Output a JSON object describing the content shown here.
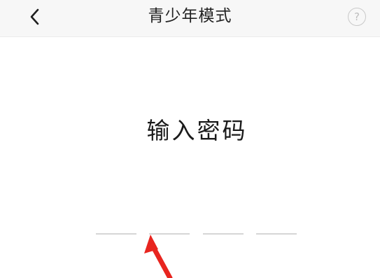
{
  "header": {
    "title": "青少年模式",
    "back_icon": "chevron-left-icon",
    "help_icon": "question-circle-icon",
    "help_glyph": "?"
  },
  "main": {
    "heading": "输入密码",
    "pin": {
      "length": 4,
      "digits": [
        "",
        "",
        "",
        ""
      ]
    }
  },
  "annotation": {
    "icon": "red-arrow-icon",
    "color": "#e8251f"
  },
  "colors": {
    "navbar_bg": "#f7f7f7",
    "text_primary": "#222222",
    "pin_underline": "#d6d6d6"
  }
}
